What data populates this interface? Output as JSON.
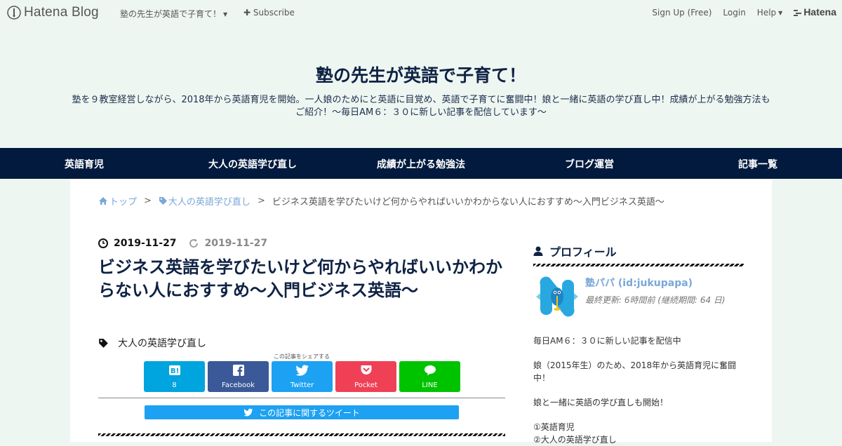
{
  "topbar": {
    "logo_text": "Hatena Blog",
    "blog_name": "塾の先生が英語で子育て！",
    "subscribe": "Subscribe",
    "signup": "Sign Up (Free)",
    "login": "Login",
    "help": "Help",
    "brand": "Hatena"
  },
  "header": {
    "title": "塾の先生が英語で子育て！",
    "description": "塾を９教室経営しながら、2018年から英語育児を開始。一人娘のためにと英語に目覚め、英語で子育てに奮闘中！娘と一緒に英語の学び直し中！成績が上がる勉強方法もご紹介！～毎日AM６：３０に新しい記事を配信しています～"
  },
  "nav": [
    "英語育児",
    "大人の英語学び直し",
    "成績が上がる勉強法",
    "ブログ運営",
    "記事一覧"
  ],
  "breadcrumb": {
    "home": "トップ",
    "category": "大人の英語学び直し",
    "current": "ビジネス英語を学びたいけど何からやればいいかわからない人におすすめ～入門ビジネス英語～",
    "separator": ">"
  },
  "article": {
    "published": "2019-11-27",
    "updated": "2019-11-27",
    "title": "ビジネス英語を学びたいけど何からやればいいかわからない人におすすめ～入門ビジネス英語～",
    "category": "大人の英語学び直し",
    "share_caption": "この記事をシェアする",
    "share_buttons": [
      {
        "label": "8",
        "icon": "hatena-bookmark-icon",
        "color": "#00a4de"
      },
      {
        "label": "Facebook",
        "icon": "facebook-icon",
        "color": "#3b5998"
      },
      {
        "label": "Twitter",
        "icon": "twitter-icon",
        "color": "#1da1f2"
      },
      {
        "label": "Pocket",
        "icon": "pocket-icon",
        "color": "#ef4056"
      },
      {
        "label": "LINE",
        "icon": "line-icon",
        "color": "#00c300"
      }
    ],
    "tweet_link": "この記事に関するツイート"
  },
  "sidebar": {
    "heading": "プロフィール",
    "name": "塾パパ (id:jukupapa)",
    "last_update": "最終更新: 6時間前 (継続期間: 64 日)",
    "paragraphs": [
      "毎日AM６：３０に新しい記事を配信中",
      "娘（2015年生）のため、2018年から英語育児に奮闘中！",
      "娘と一緒に英語の学び直しも開始！"
    ],
    "list": [
      "①英語育児",
      "②大人の英語学び直し"
    ]
  },
  "colors": {
    "background": "#eef6f1",
    "nav_bg": "#011a3d",
    "title": "#0f2244",
    "link": "#7aa7d8"
  }
}
